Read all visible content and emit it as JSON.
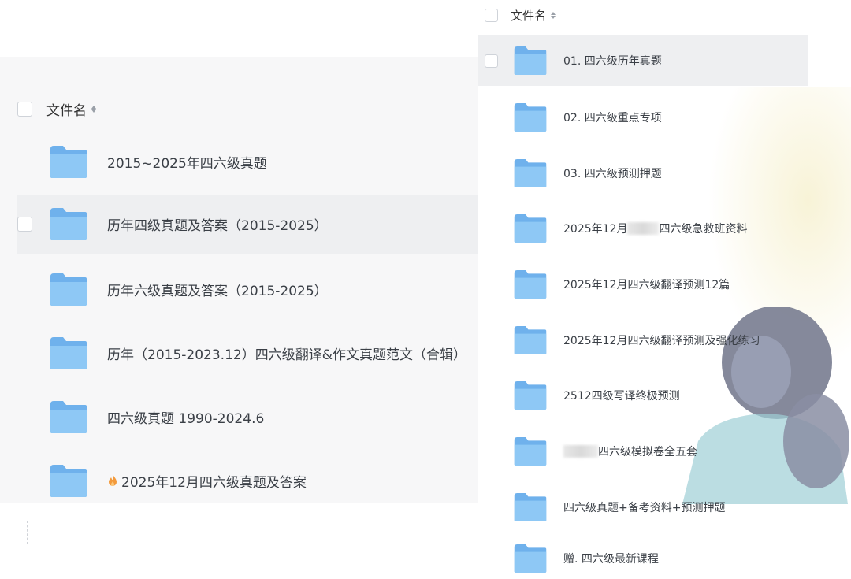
{
  "left": {
    "header_label": "文件名",
    "rows": [
      {
        "label": "2015~2025年四六级真题"
      },
      {
        "label": "历年四级真题及答案（2015-2025）"
      },
      {
        "label": "历年六级真题及答案（2015-2025）"
      },
      {
        "label": "历年（2015-2023.12）四六级翻译&作文真题范文（合辑）"
      },
      {
        "label": "四六级真题 1990-2024.6"
      },
      {
        "label": "2025年12月四六级真题及答案"
      }
    ]
  },
  "right": {
    "header_label": "文件名",
    "rows": [
      {
        "label": "01. 四六级历年真题"
      },
      {
        "label": "02. 四六级重点专项"
      },
      {
        "label": "03. 四六级预测押题"
      },
      {
        "label_a": "2025年12月",
        "label_b": "四六级急救班资料"
      },
      {
        "label": "2025年12月四六级翻译预测12篇"
      },
      {
        "label": "2025年12月四六级翻译预测及强化练习"
      },
      {
        "label": "2512四级写译终极预测"
      },
      {
        "label_b": "四六级模拟卷全五套"
      },
      {
        "label": "四六级真题+备考资料+预测押题"
      },
      {
        "label": "赠. 四六级最新课程"
      }
    ]
  },
  "colors": {
    "folder_light": "#8ec8f5",
    "folder_dark": "#6fb1ec",
    "selected_row": "#eeeff1",
    "fire": "#f39a3b"
  },
  "icons": {
    "folder": "folder-icon",
    "sort": "sort-icon",
    "fire": "fire-icon"
  }
}
